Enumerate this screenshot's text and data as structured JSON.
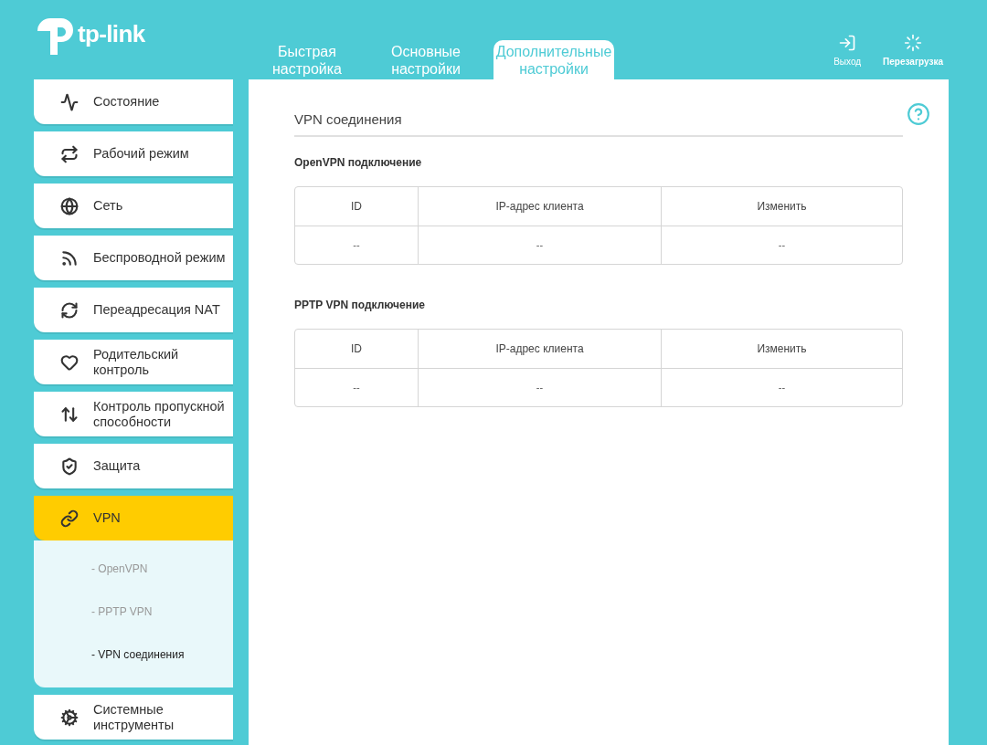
{
  "header": {
    "logo_text": "tp-link",
    "tabs": [
      {
        "label": "Быстрая настройка",
        "selected": false
      },
      {
        "label": "Основные настройки",
        "selected": false
      },
      {
        "label": "Дополнительные настройки",
        "selected": true
      }
    ],
    "actions": [
      "Выход",
      "Перезагрузка"
    ]
  },
  "sidebar": {
    "items": [
      {
        "label": "Состояние",
        "selected": false
      },
      {
        "label": "Рабочий режим",
        "selected": false
      },
      {
        "label": "Сеть",
        "selected": false
      },
      {
        "label": "Беспроводной режим",
        "selected": false
      },
      {
        "label": "Переадресация NAT",
        "selected": false
      },
      {
        "label": "Родительский контроль",
        "selected": false
      },
      {
        "label": "Контроль пропускной способности",
        "selected": false
      },
      {
        "label": "Защита",
        "selected": false
      },
      {
        "label": "VPN",
        "selected": true,
        "expanded": true,
        "children": [
          {
            "label": "- OpenVPN",
            "selected": false
          },
          {
            "label": "- PPTP VPN",
            "selected": false
          },
          {
            "label": "- VPN соединения",
            "selected": true
          }
        ]
      },
      {
        "label": "Системные инструменты",
        "selected": false
      }
    ]
  },
  "main": {
    "title": "VPN соединения",
    "tables": [
      {
        "title": "OpenVPN подключение",
        "columns": [
          "ID",
          "IP-адрес клиента",
          "Изменить"
        ],
        "rows": [
          [
            "--",
            "--",
            "--"
          ]
        ]
      },
      {
        "title": "PPTP VPN подключение",
        "columns": [
          "ID",
          "IP-адрес клиента",
          "Изменить"
        ],
        "rows": [
          [
            "--",
            "--",
            "--"
          ]
        ]
      }
    ]
  }
}
